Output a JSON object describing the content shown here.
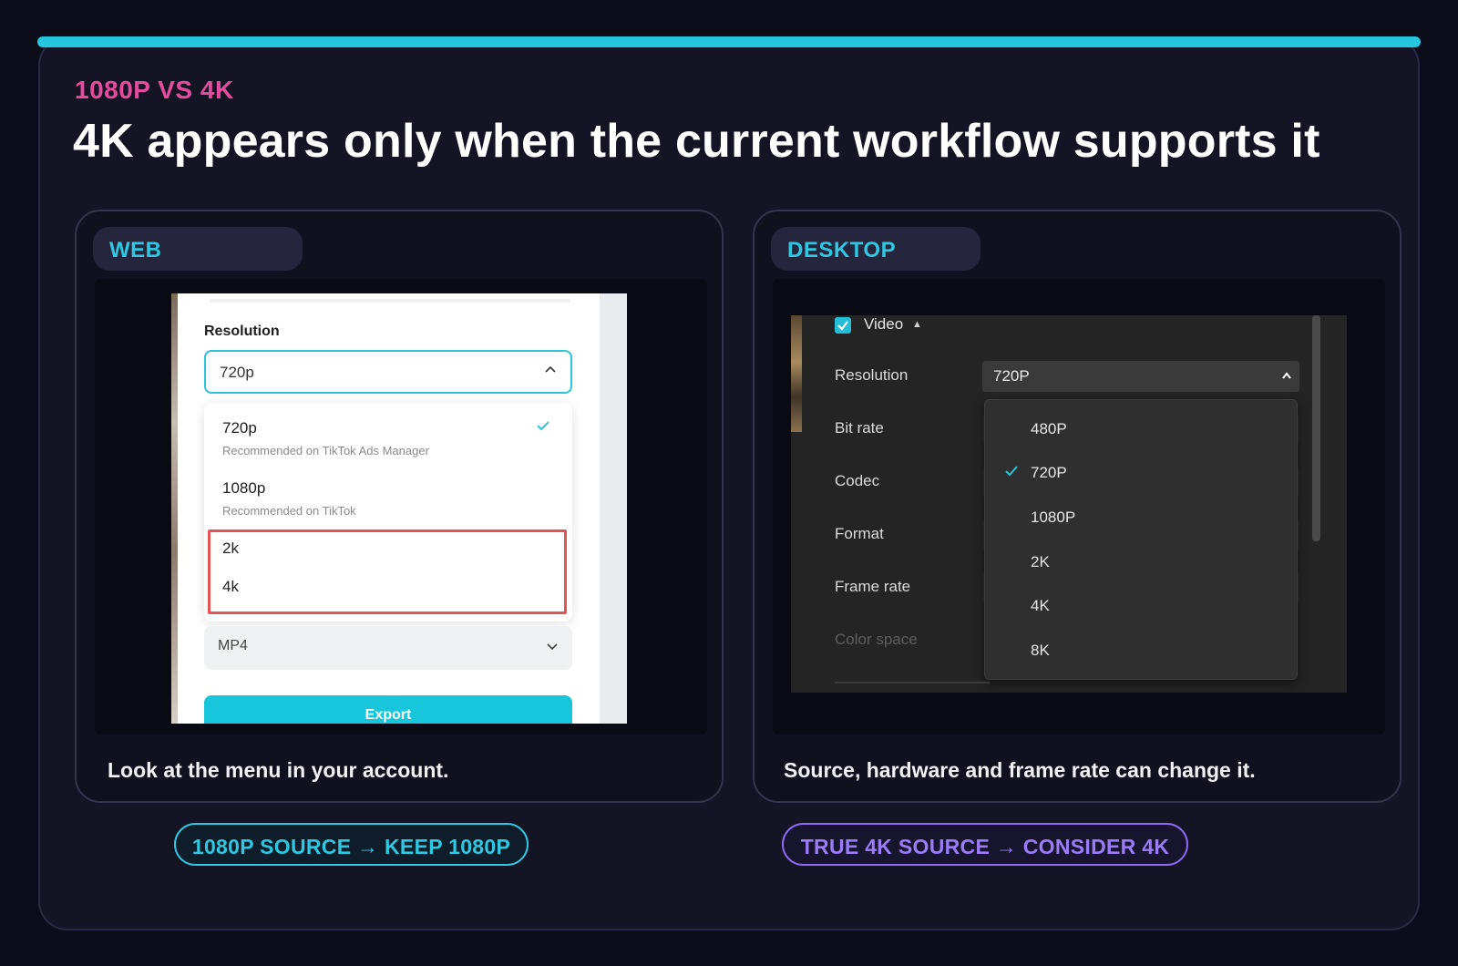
{
  "header": {
    "eyebrow": "1080P VS 4K",
    "headline": "4K appears only when the current workflow supports it"
  },
  "web_panel": {
    "badge": "WEB",
    "caption": "Look at the menu in your account.",
    "screenshot": {
      "field_label": "Resolution",
      "selected_value": "720p",
      "options": [
        {
          "label": "720p",
          "sub": "Recommended on TikTok Ads Manager",
          "checked": true
        },
        {
          "label": "1080p",
          "sub": "Recommended on TikTok",
          "checked": false
        },
        {
          "label": "2k",
          "sub": "",
          "checked": false
        },
        {
          "label": "4k",
          "sub": "",
          "checked": false
        }
      ],
      "format_value": "MP4",
      "export_label": "Export",
      "highlight_color": "#e35454"
    }
  },
  "desktop_panel": {
    "badge": "DESKTOP",
    "caption": "Source, hardware and frame rate can change it.",
    "screenshot": {
      "section_label": "Video",
      "rows": [
        "Resolution",
        "Bit rate",
        "Codec",
        "Format",
        "Frame rate",
        "Color space"
      ],
      "selected_value": "720P",
      "options": [
        "480P",
        "720P",
        "1080P",
        "2K",
        "4K",
        "8K"
      ],
      "checked_option": "720P"
    }
  },
  "tags": {
    "left": "1080P SOURCE → KEEP 1080P",
    "right": "TRUE 4K SOURCE → CONSIDER 4K"
  },
  "colors": {
    "accent_cyan": "#26c6de",
    "accent_pink": "#e64c9c",
    "accent_purple": "#8d6bf5",
    "background": "#0b0b19"
  }
}
